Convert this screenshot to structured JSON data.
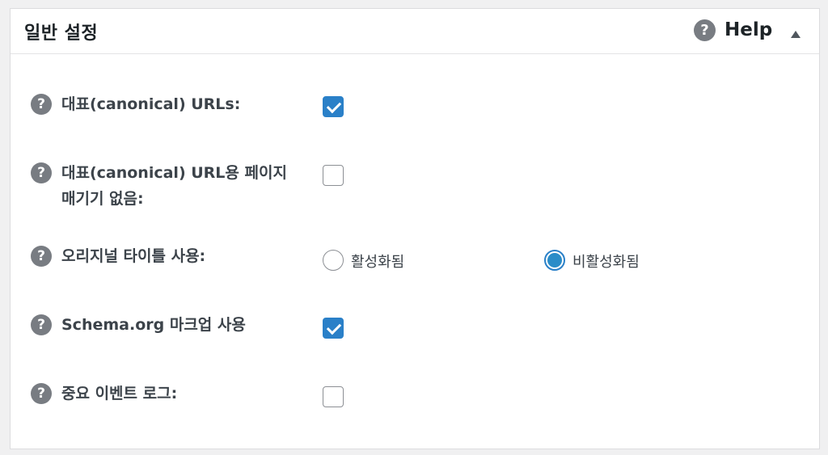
{
  "panel": {
    "title": "일반 설정",
    "help_icon_text": "?",
    "help_label": "Help",
    "collapse_icon": "triangle-up-icon"
  },
  "rows": [
    {
      "help_icon_text": "?",
      "label": "대표(canonical) URLs:",
      "control": "checkbox",
      "checked": true
    },
    {
      "help_icon_text": "?",
      "label": "대표(canonical) URL용 페이지 매기기 없음:",
      "control": "checkbox",
      "checked": false
    },
    {
      "help_icon_text": "?",
      "label": "오리지널 타이틀 사용:",
      "control": "radio",
      "options": [
        {
          "label": "활성화됨",
          "selected": false
        },
        {
          "label": "비활성화됨",
          "selected": true
        }
      ]
    },
    {
      "help_icon_text": "?",
      "label": "Schema.org 마크업 사용",
      "control": "checkbox",
      "checked": true
    },
    {
      "help_icon_text": "?",
      "label": "중요 이벤트 로그:",
      "control": "checkbox",
      "checked": false
    }
  ],
  "colors": {
    "accent": "#2a80c8",
    "help_icon": "#787c82",
    "label_text": "#3c434a"
  }
}
